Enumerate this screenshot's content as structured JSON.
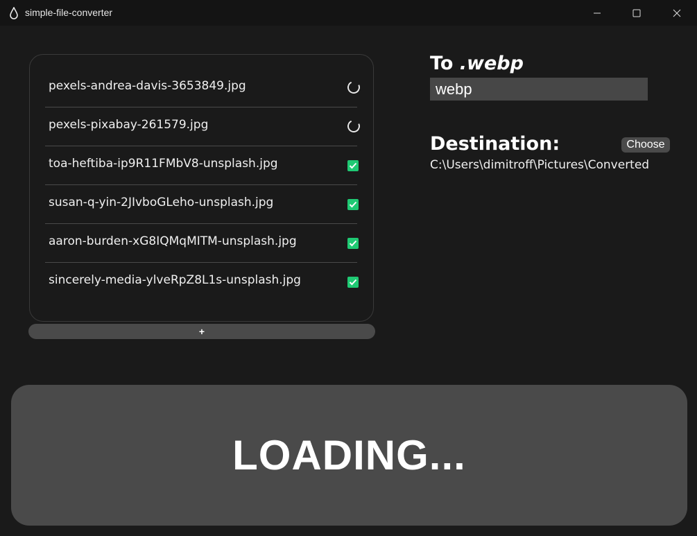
{
  "window": {
    "title": "simple-file-converter"
  },
  "files": [
    {
      "name": "pexels-andrea-davis-3653849.jpg",
      "status": "loading"
    },
    {
      "name": "pexels-pixabay-261579.jpg",
      "status": "loading"
    },
    {
      "name": "toa-heftiba-ip9R11FMbV8-unsplash.jpg",
      "status": "done"
    },
    {
      "name": "susan-q-yin-2JIvboGLeho-unsplash.jpg",
      "status": "done"
    },
    {
      "name": "aaron-burden-xG8IQMqMITM-unsplash.jpg",
      "status": "done"
    },
    {
      "name": "sincerely-media-ylveRpZ8L1s-unsplash.jpg",
      "status": "done"
    }
  ],
  "add_button": {
    "label": "+"
  },
  "target": {
    "heading_prefix": "To ",
    "heading_ext": ".webp",
    "format_value": "webp"
  },
  "destination": {
    "heading": "Destination:",
    "choose_label": "Choose",
    "path": "C:\\Users\\dimitroff\\Pictures\\Converted"
  },
  "status_panel": {
    "text": "LOADING..."
  },
  "colors": {
    "background": "#1e1e1e",
    "panel": "#4a4a4a",
    "check": "#1fc973"
  }
}
